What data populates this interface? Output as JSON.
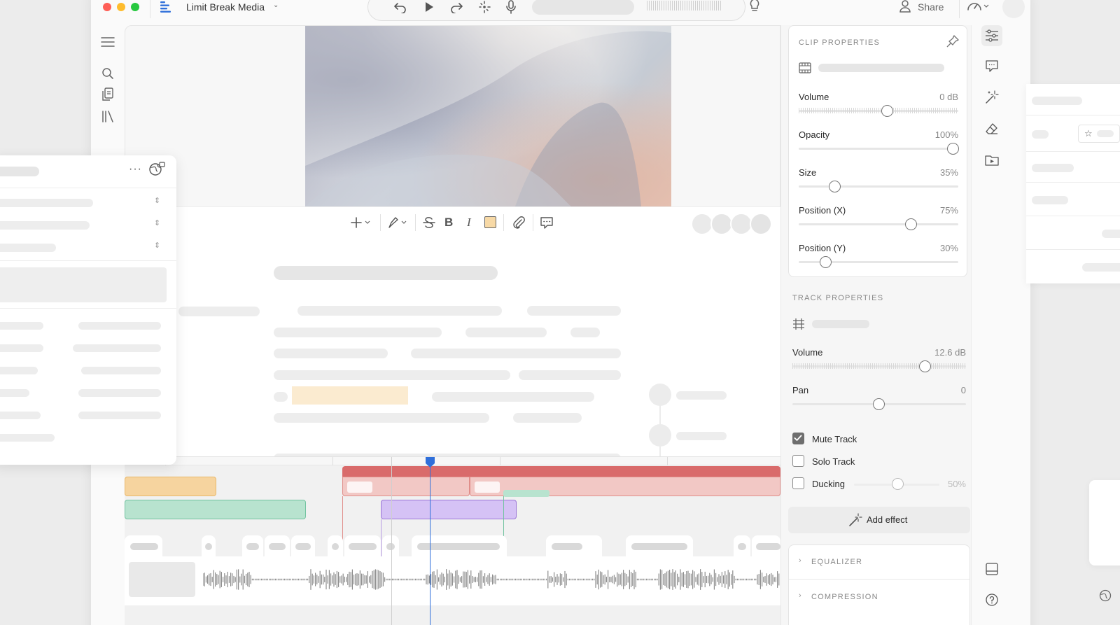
{
  "window": {
    "title": "Limit Break Media",
    "share_label": "Share",
    "traffic_lights": [
      "#fe5f57",
      "#febc2e",
      "#28c840"
    ]
  },
  "toolbar": {
    "icons": [
      "undo-icon",
      "play-icon",
      "redo-icon",
      "sparkle-icon",
      "mic-icon"
    ]
  },
  "clip_properties": {
    "heading": "CLIP PROPERTIES",
    "rows": [
      {
        "label": "Volume",
        "value": "0 dB",
        "level": 0.56
      },
      {
        "label": "Opacity",
        "value": "100%",
        "level": 1.0
      },
      {
        "label": "Size",
        "value": "35%",
        "level": 0.21
      },
      {
        "label": "Position (X)",
        "value": "75%",
        "level": 0.72
      },
      {
        "label": "Position (Y)",
        "value": "30%",
        "level": 0.15
      }
    ]
  },
  "track_properties": {
    "heading": "TRACK PROPERTIES",
    "rows": [
      {
        "label": "Volume",
        "value": "12.6 dB",
        "level": 0.78
      },
      {
        "label": "Pan",
        "value": "0",
        "level": 0.5
      }
    ],
    "options": [
      {
        "label": "Mute Track",
        "checked": true
      },
      {
        "label": "Solo Track",
        "checked": false
      },
      {
        "label": "Ducking",
        "checked": false,
        "value": "50%",
        "level": 0.5
      }
    ],
    "add_effect_label": "Add effect"
  },
  "effects": [
    "EQUALIZER",
    "COMPRESSION"
  ],
  "colors": {
    "accent": "#2f6fda",
    "clip_orange": "#f6d49f",
    "clip_green": "#b8e3cf",
    "clip_red": "#d96b6b",
    "clip_purple": "#d5c2f5",
    "highlight": "#fbebd0"
  }
}
